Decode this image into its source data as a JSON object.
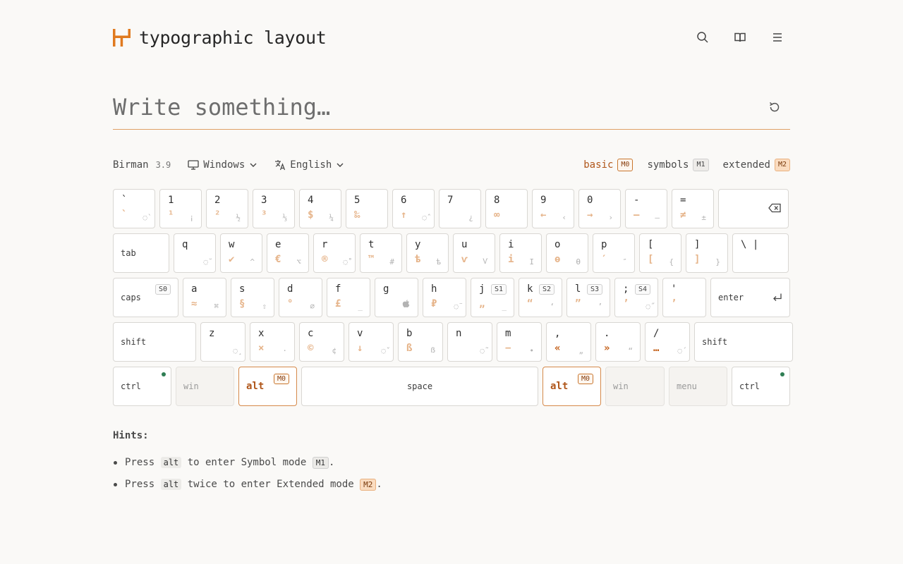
{
  "header": {
    "title": "typographic layout",
    "icons": [
      "search-icon",
      "book-icon",
      "menu-icon"
    ],
    "accent": "#e07a1f"
  },
  "editor": {
    "placeholder": "Write something…"
  },
  "toolbar": {
    "layout_name": "Birman",
    "layout_version": "3.9",
    "os": "Windows",
    "language": "English",
    "modes": [
      {
        "label": "basic",
        "badge": "M0"
      },
      {
        "label": "symbols",
        "badge": "M1"
      },
      {
        "label": "extended",
        "badge": "M2"
      }
    ]
  },
  "keys": {
    "r1": [
      {
        "main": "`",
        "s1": "`",
        "s2": "◌̀"
      },
      {
        "main": "1",
        "s1": "¹",
        "s2": "¡"
      },
      {
        "main": "2",
        "s1": "²",
        "s2": "½"
      },
      {
        "main": "3",
        "s1": "³",
        "s2": "⅓"
      },
      {
        "main": "4",
        "s1": "$",
        "s2": "¼"
      },
      {
        "main": "5",
        "s1": "‰",
        "s2": ""
      },
      {
        "main": "6",
        "s1": "↑",
        "s2": "◌̂"
      },
      {
        "main": "7",
        "s1": "",
        "s2": "¿"
      },
      {
        "main": "8",
        "s1": "∞",
        "s2": ""
      },
      {
        "main": "9",
        "s1": "←",
        "s2": "‹"
      },
      {
        "main": "0",
        "s1": "→",
        "s2": "›"
      },
      {
        "main": "-",
        "s1": "—",
        "s2": "–"
      },
      {
        "main": "=",
        "s1": "≠",
        "s2": "±"
      }
    ],
    "r2": [
      {
        "main": "q",
        "s1": "",
        "s2": "◌̆"
      },
      {
        "main": "w",
        "s1": "✔",
        "s2": "^"
      },
      {
        "main": "e",
        "s1": "€",
        "s2": "⌥"
      },
      {
        "main": "r",
        "s1": "®",
        "s2": "◌̊"
      },
      {
        "main": "t",
        "s1": "™",
        "s2": "#"
      },
      {
        "main": "y",
        "s1": "ѣ",
        "s2": "ѣ"
      },
      {
        "main": "u",
        "s1": "ѵ",
        "s2": "Ѵ"
      },
      {
        "main": "i",
        "s1": "і",
        "s2": "І"
      },
      {
        "main": "o",
        "s1": "ѳ",
        "s2": "Ѳ"
      },
      {
        "main": "p",
        "s1": "′",
        "s2": "″"
      },
      {
        "main": "[",
        "s1": "[",
        "s2": "{"
      },
      {
        "main": "]",
        "s1": "]",
        "s2": "}"
      },
      {
        "main": "\\ |",
        "s1": "",
        "s2": ""
      }
    ],
    "r3": [
      {
        "main": "a",
        "s1": "≈",
        "s2": "⌘"
      },
      {
        "main": "s",
        "s1": "§",
        "s2": "⇧"
      },
      {
        "main": "d",
        "s1": "°",
        "s2": "⌀"
      },
      {
        "main": "f",
        "s1": "£",
        "s2": "_"
      },
      {
        "main": "g",
        "s1": "",
        "s2": ""
      },
      {
        "main": "h",
        "s1": "₽",
        "s2": "◌̈"
      },
      {
        "main": "j",
        "s1": "„",
        "s2": "_",
        "badge": "S1"
      },
      {
        "main": "k",
        "s1": "“",
        "s2": "‘",
        "badge": "S2"
      },
      {
        "main": "l",
        "s1": "”",
        "s2": "’",
        "badge": "S3"
      },
      {
        "main": ";",
        "s1": "’",
        "s2": "◌̋",
        "badge": "S4"
      },
      {
        "main": "'",
        "s1": "’",
        "s2": ""
      }
    ],
    "r4": [
      {
        "main": "z",
        "s1": "",
        "s2": "◌̧"
      },
      {
        "main": "x",
        "s1": "×",
        "s2": "·"
      },
      {
        "main": "c",
        "s1": "©",
        "s2": "¢"
      },
      {
        "main": "v",
        "s1": "↓",
        "s2": "◌̌"
      },
      {
        "main": "b",
        "s1": "ß",
        "s2": "ẞ"
      },
      {
        "main": "n",
        "s1": "",
        "s2": "◌̃"
      },
      {
        "main": "m",
        "s1": "−",
        "s2": "•"
      },
      {
        "main": ",",
        "s1": "«",
        "s2": "„",
        "dark": true
      },
      {
        "main": ".",
        "s1": "»",
        "s2": "“",
        "dark": true
      },
      {
        "main": "/",
        "s1": "…",
        "s2": "◌́",
        "dark": true
      }
    ]
  },
  "mods": {
    "tab": "tab",
    "caps": "caps",
    "caps_badge": "S0",
    "enter": "enter",
    "shift_left": "shift",
    "shift_right": "shift",
    "ctrl_left": "ctrl",
    "win_left": "win",
    "alt_left": "alt",
    "alt_left_badge": "M0",
    "space": "space",
    "alt_right": "alt",
    "alt_right_badge": "M0",
    "win_right": "win",
    "menu": "menu",
    "ctrl_right": "ctrl"
  },
  "hints": {
    "title": "Hints:",
    "line1": {
      "pre": "Press",
      "key": "alt",
      "mid": "to enter Symbol mode",
      "badge": "M1",
      "end": "."
    },
    "line2": {
      "pre": "Press",
      "key": "alt",
      "mid": "twice to enter Extended mode",
      "badge": "M2",
      "end": "."
    }
  }
}
